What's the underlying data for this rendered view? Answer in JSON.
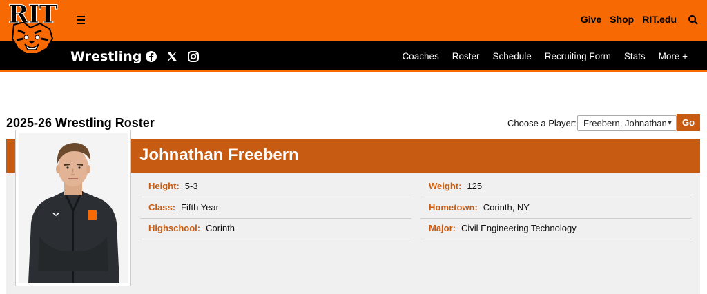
{
  "header": {
    "logo_text": "RIT",
    "top_links": [
      "Give",
      "Shop",
      "RIT.edu"
    ]
  },
  "nav": {
    "sport_title": "Wrestling",
    "links": [
      "Coaches",
      "Roster",
      "Schedule",
      "Recruiting Form",
      "Stats",
      "More +"
    ]
  },
  "roster": {
    "title": "2025-26 Wrestling Roster",
    "choose_label": "Choose a Player:",
    "selected_player": "Freebern, Johnathan",
    "go_label": "Go"
  },
  "player": {
    "name": "Johnathan Freebern",
    "left": [
      {
        "label": "Height:",
        "value": "5-3"
      },
      {
        "label": "Class:",
        "value": "Fifth Year"
      },
      {
        "label": "Highschool:",
        "value": "Corinth"
      }
    ],
    "right": [
      {
        "label": "Weight:",
        "value": "125"
      },
      {
        "label": "Hometown:",
        "value": "Corinth, NY"
      },
      {
        "label": "Major:",
        "value": "Civil Engineering Technology"
      }
    ]
  },
  "colors": {
    "brand_orange": "#f76902",
    "accent_orange": "#c75b12",
    "nav_black": "#000000"
  }
}
